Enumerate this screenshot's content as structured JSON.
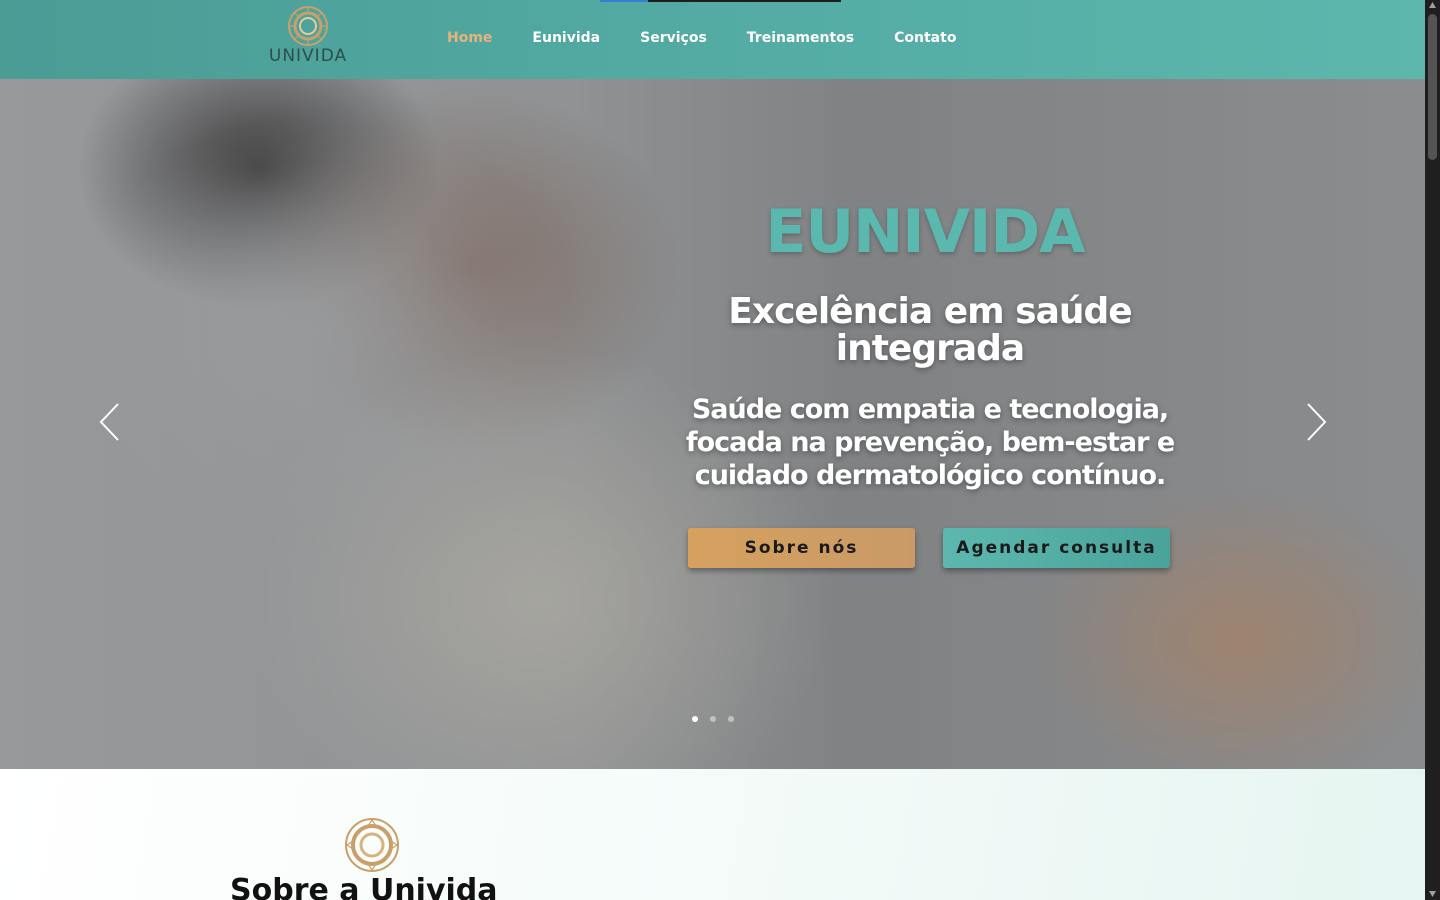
{
  "header": {
    "logo_text": "UNIVIDA",
    "nav": [
      {
        "label": "Home",
        "active": true
      },
      {
        "label": "Eunivida",
        "active": false
      },
      {
        "label": "Serviços",
        "active": false
      },
      {
        "label": "Treinamentos",
        "active": false
      },
      {
        "label": "Contato",
        "active": false
      }
    ]
  },
  "hero": {
    "title": "EUNIVIDA",
    "subtitle": "Excelência em saúde integrada",
    "text": "Saúde com empatia e tecnologia, focada na prevenção, bem-estar e cuidado dermatológico contínuo.",
    "buttons": {
      "about": "Sobre nós",
      "book": "Agendar consulta"
    },
    "slides_count": 3,
    "active_slide": 1
  },
  "about": {
    "title": "Sobre a Univida"
  },
  "colors": {
    "teal": "#5ab8ae",
    "gold": "#d6a15e",
    "nav_active": "#e5b37c"
  },
  "icons": [
    "logo-emblem-icon",
    "chevron-left-icon",
    "chevron-right-icon",
    "scroll-up-icon",
    "scroll-down-icon"
  ]
}
